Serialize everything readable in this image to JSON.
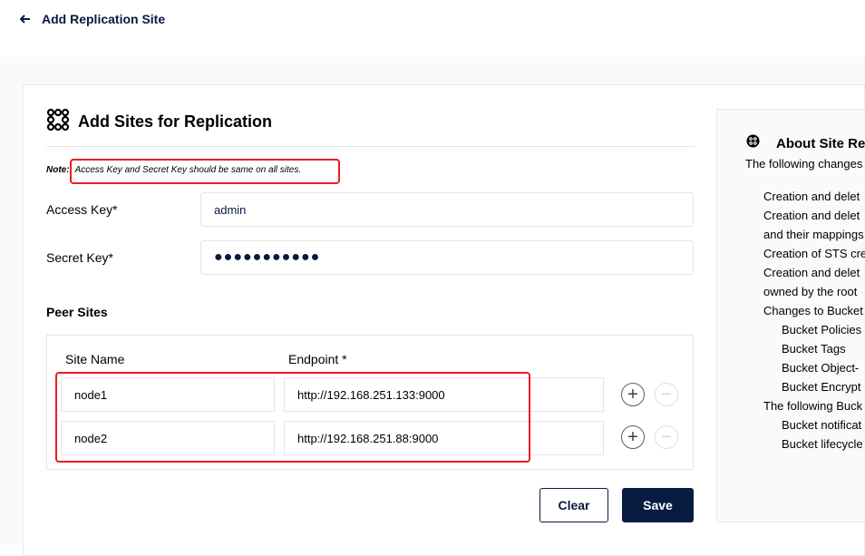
{
  "header": {
    "back_icon": "arrow-left-icon",
    "title": "Add Replication Site"
  },
  "form": {
    "title": "Add Sites for Replication",
    "title_icon": "replication-cluster-icon",
    "note_label": "Note:",
    "note_text": "Access Key and Secret Key should be same on all sites.",
    "access_key_label": "Access Key*",
    "access_key_value": "admin",
    "secret_key_label": "Secret Key*",
    "secret_key_value": "●●●●●●●●●●●",
    "peer_sites_title": "Peer Sites",
    "columns": {
      "site_name": "Site Name",
      "endpoint": "Endpoint *"
    },
    "peers": [
      {
        "name": "node1",
        "endpoint": "http://192.168.251.133:9000"
      },
      {
        "name": "node2",
        "endpoint": "http://192.168.251.88:9000"
      }
    ],
    "add_icon": "plus-circle-icon",
    "remove_icon": "minus-circle-icon",
    "clear_label": "Clear",
    "save_label": "Save"
  },
  "help": {
    "title": "About Site Re",
    "intro": "The following changes",
    "items": [
      {
        "text": "Creation and delet",
        "sub": false
      },
      {
        "text": "Creation and delet",
        "sub": false
      },
      {
        "text": "and their mappings",
        "sub": false
      },
      {
        "text": "Creation of STS cre",
        "sub": false
      },
      {
        "text": "Creation and delet",
        "sub": false
      },
      {
        "text": "owned by the root",
        "sub": false
      },
      {
        "text": "Changes to Bucket",
        "sub": false
      },
      {
        "text": "Bucket Policies",
        "sub": true
      },
      {
        "text": "Bucket Tags",
        "sub": true
      },
      {
        "text": "Bucket Object-",
        "sub": true
      },
      {
        "text": "Bucket Encrypt",
        "sub": true
      },
      {
        "text": "The following Buck",
        "sub": false
      },
      {
        "text": "Bucket notificat",
        "sub": true
      },
      {
        "text": "Bucket lifecycle",
        "sub": true
      }
    ]
  },
  "colors": {
    "primary": "#081c42",
    "highlight": "#ec1c24"
  }
}
